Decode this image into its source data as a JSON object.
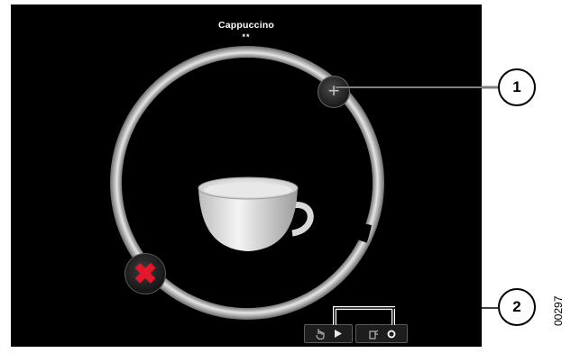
{
  "screen": {
    "product_name": "Cappuccino",
    "strength": "**",
    "plus_symbol": "+",
    "cancel_symbol": "✖",
    "cancel_color": "#e3162c",
    "progress_fraction": 0.98
  },
  "callouts": {
    "one": "1",
    "two": "2"
  },
  "footer_icons": [
    "hand-press-icon",
    "play-icon",
    "cup-dispense-icon",
    "ring-icon"
  ],
  "document_code": "00297"
}
